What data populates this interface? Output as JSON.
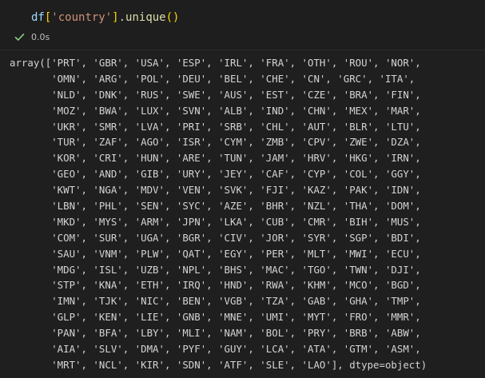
{
  "cell": {
    "code": {
      "ident": "df",
      "open_bracket": "[",
      "string": "'country'",
      "close_bracket": "]",
      "dot": ".",
      "method": "unique",
      "parens": "()"
    },
    "status": {
      "icon": "check-icon",
      "icon_color": "#89d185",
      "duration": "0.0s"
    }
  },
  "output": {
    "lines": [
      "array(['PRT', 'GBR', 'USA', 'ESP', 'IRL', 'FRA', 'OTH', 'ROU', 'NOR',",
      "       'OMN', 'ARG', 'POL', 'DEU', 'BEL', 'CHE', 'CN', 'GRC', 'ITA',",
      "       'NLD', 'DNK', 'RUS', 'SWE', 'AUS', 'EST', 'CZE', 'BRA', 'FIN',",
      "       'MOZ', 'BWA', 'LUX', 'SVN', 'ALB', 'IND', 'CHN', 'MEX', 'MAR',",
      "       'UKR', 'SMR', 'LVA', 'PRI', 'SRB', 'CHL', 'AUT', 'BLR', 'LTU',",
      "       'TUR', 'ZAF', 'AGO', 'ISR', 'CYM', 'ZMB', 'CPV', 'ZWE', 'DZA',",
      "       'KOR', 'CRI', 'HUN', 'ARE', 'TUN', 'JAM', 'HRV', 'HKG', 'IRN',",
      "       'GEO', 'AND', 'GIB', 'URY', 'JEY', 'CAF', 'CYP', 'COL', 'GGY',",
      "       'KWT', 'NGA', 'MDV', 'VEN', 'SVK', 'FJI', 'KAZ', 'PAK', 'IDN',",
      "       'LBN', 'PHL', 'SEN', 'SYC', 'AZE', 'BHR', 'NZL', 'THA', 'DOM',",
      "       'MKD', 'MYS', 'ARM', 'JPN', 'LKA', 'CUB', 'CMR', 'BIH', 'MUS',",
      "       'COM', 'SUR', 'UGA', 'BGR', 'CIV', 'JOR', 'SYR', 'SGP', 'BDI',",
      "       'SAU', 'VNM', 'PLW', 'QAT', 'EGY', 'PER', 'MLT', 'MWI', 'ECU',",
      "       'MDG', 'ISL', 'UZB', 'NPL', 'BHS', 'MAC', 'TGO', 'TWN', 'DJI',",
      "       'STP', 'KNA', 'ETH', 'IRQ', 'HND', 'RWA', 'KHM', 'MCO', 'BGD',",
      "       'IMN', 'TJK', 'NIC', 'BEN', 'VGB', 'TZA', 'GAB', 'GHA', 'TMP',",
      "       'GLP', 'KEN', 'LIE', 'GNB', 'MNE', 'UMI', 'MYT', 'FRO', 'MMR',",
      "       'PAN', 'BFA', 'LBY', 'MLI', 'NAM', 'BOL', 'PRY', 'BRB', 'ABW',",
      "       'AIA', 'SLV', 'DMA', 'PYF', 'GUY', 'LCA', 'ATA', 'GTM', 'ASM',",
      "       'MRT', 'NCL', 'KIR', 'SDN', 'ATF', 'SLE', 'LAO'], dtype=object)"
    ]
  }
}
